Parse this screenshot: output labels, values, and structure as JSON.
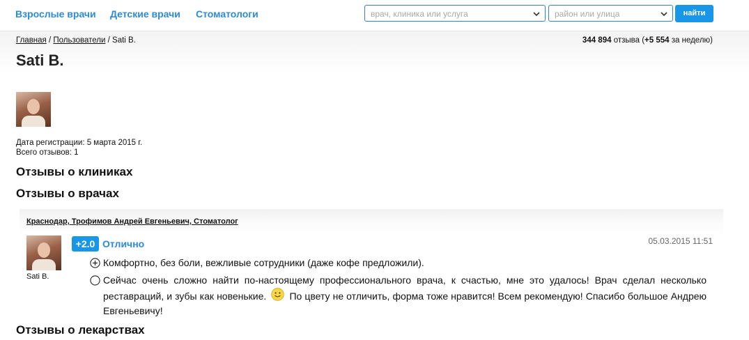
{
  "nav": {
    "adult_doctors": "Взрослые врачи",
    "child_doctors": "Детские врачи",
    "dentists": "Стоматологи"
  },
  "search": {
    "query_placeholder": "врач, клиника или услуга",
    "location_placeholder": "район или улица",
    "button_label": "найти"
  },
  "breadcrumb": {
    "home": "Главная",
    "separator": " / ",
    "users": "Пользователи",
    "current": "Sati B."
  },
  "stats": {
    "total": "344 894",
    "total_label": " отзыва (",
    "week": "+5 554",
    "week_label": " за неделю)"
  },
  "profile": {
    "name": "Sati B.",
    "registration": "Дата регистрации: 5 марта 2015 г.",
    "reviews_count": "Всего отзывов: 1"
  },
  "sections": {
    "clinics": "Отзывы о клиниках",
    "doctors": "Отзывы о врачах",
    "drugs": "Отзывы о лекарствах"
  },
  "review": {
    "doctor_link": "Краснодар, Трофимов Андрей Евгеньевич, Стоматолог",
    "author": "Sati B.",
    "score": "+2.0",
    "rating_label": "Отлично",
    "date": "05.03.2015 11:51",
    "pros": "Комфортно, без боли, вежливые сотрудники (даже кофе предложили).",
    "comment_part1": "Сейчас очень сложно найти по-настоящему профессионального врача, к счастью, мне это удалось! Врач сделал несколько реставраций, и зубы как новенькие.",
    "comment_part2": "По цвету не отличить, форма тоже нравится! Всем рекомендую! Спасибо большое Андрею Евгеньевичу!"
  },
  "colors": {
    "link_blue": "#2c8ad6",
    "button_blue": "#1a96e8",
    "input_border": "#2f83c4"
  },
  "icons": {
    "pros": "plus-circle-icon",
    "comment": "circle-icon",
    "emoji": "smiley-icon",
    "dropdown": "chevron-down-icon"
  }
}
